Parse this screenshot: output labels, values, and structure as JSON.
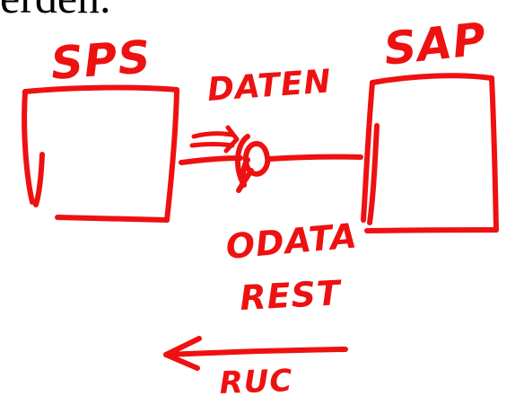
{
  "page": {
    "printed_fragment": "erden."
  },
  "diagram": {
    "left_box_label": "SPS",
    "right_box_label": "SAP",
    "top_label": "DATEN",
    "middle_label_1": "ODATA",
    "middle_label_2": "REST",
    "bottom_label": "RUC"
  },
  "colors": {
    "ink": "#ee1111",
    "printed_text": "#000000"
  }
}
